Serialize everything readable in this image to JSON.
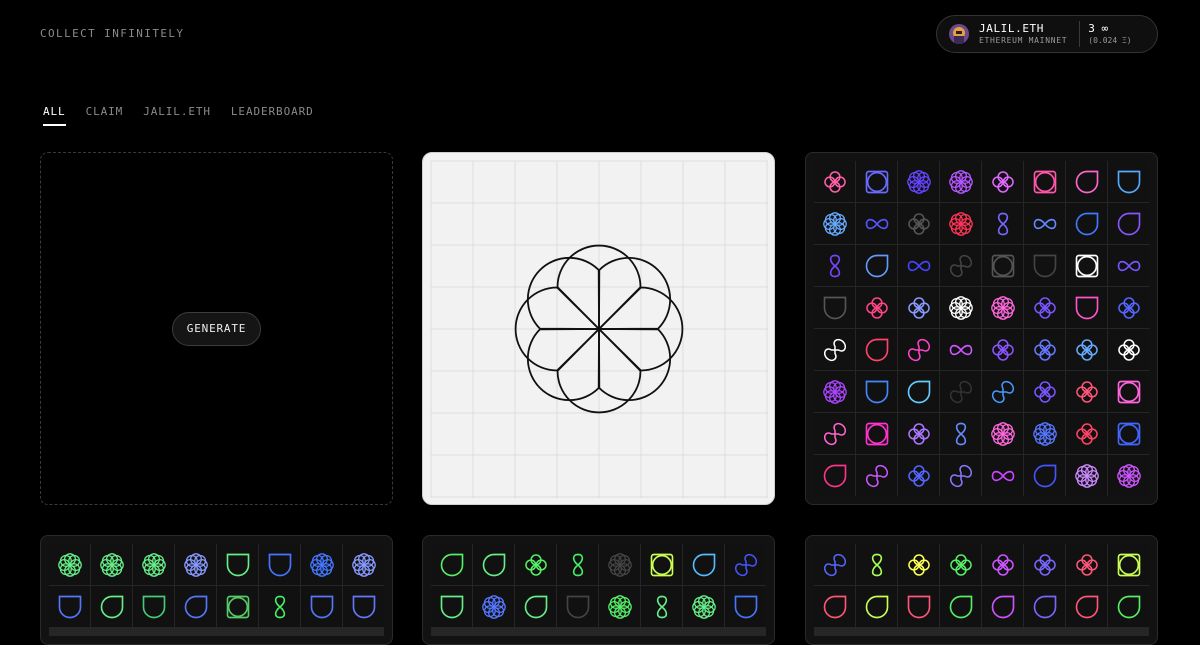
{
  "brand": "COLLECT INFINITELY",
  "wallet": {
    "name": "JALIL.ETH",
    "network": "ETHEREUM MAINNET",
    "count": "3 ∞",
    "eth": "(0.024 Ξ)"
  },
  "tabs": [
    {
      "label": "ALL",
      "active": true
    },
    {
      "label": "CLAIM",
      "active": false
    },
    {
      "label": "JALIL.ETH",
      "active": false
    },
    {
      "label": "LEADERBOARD",
      "active": false
    }
  ],
  "generate_label": "GENERATE",
  "preview": {
    "shape": "flower8",
    "stroke": "#111111"
  },
  "collections": [
    {
      "cols": 8,
      "rows": 8,
      "tokens": [
        {
          "s": "clover",
          "c": "#ff5fa8"
        },
        {
          "s": "square",
          "c": "#6a6aff"
        },
        {
          "s": "flower",
          "c": "#6644ff"
        },
        {
          "s": "flower",
          "c": "#b455ff"
        },
        {
          "s": "clover",
          "c": "#e066ff"
        },
        {
          "s": "square",
          "c": "#ff55aa"
        },
        {
          "s": "drop",
          "c": "#ff66cc"
        },
        {
          "s": "arch",
          "c": "#55aaff"
        },
        {
          "s": "flower",
          "c": "#66aaff"
        },
        {
          "s": "inf",
          "c": "#5555ff"
        },
        {
          "s": "clover",
          "c": "#555555"
        },
        {
          "s": "flower",
          "c": "#ff3355"
        },
        {
          "s": "eight",
          "c": "#7766ff"
        },
        {
          "s": "inf",
          "c": "#6688ff"
        },
        {
          "s": "drop",
          "c": "#4477ff"
        },
        {
          "s": "drop",
          "c": "#8855ff"
        },
        {
          "s": "eight",
          "c": "#7744ff"
        },
        {
          "s": "drop",
          "c": "#6699ff"
        },
        {
          "s": "inf",
          "c": "#4444ff"
        },
        {
          "s": "wave",
          "c": "#444444"
        },
        {
          "s": "square",
          "c": "#555555"
        },
        {
          "s": "arch",
          "c": "#444444"
        },
        {
          "s": "square",
          "c": "#ffffff"
        },
        {
          "s": "inf",
          "c": "#7755ff"
        },
        {
          "s": "arch",
          "c": "#555555"
        },
        {
          "s": "clover",
          "c": "#ff4488"
        },
        {
          "s": "clover",
          "c": "#8899ff"
        },
        {
          "s": "flower",
          "c": "#ffffff"
        },
        {
          "s": "flower",
          "c": "#ff66dd"
        },
        {
          "s": "clover",
          "c": "#7755ff"
        },
        {
          "s": "arch",
          "c": "#ff55cc"
        },
        {
          "s": "clover",
          "c": "#5566ff"
        },
        {
          "s": "wave",
          "c": "#ffffff"
        },
        {
          "s": "drop",
          "c": "#ff4466"
        },
        {
          "s": "wave",
          "c": "#ff44cc"
        },
        {
          "s": "inf",
          "c": "#cc55ff"
        },
        {
          "s": "clover",
          "c": "#8855ff"
        },
        {
          "s": "clover",
          "c": "#6677ff"
        },
        {
          "s": "clover",
          "c": "#66aaff"
        },
        {
          "s": "clover",
          "c": "#ffffff"
        },
        {
          "s": "flower",
          "c": "#aa44ff"
        },
        {
          "s": "arch",
          "c": "#4488ff"
        },
        {
          "s": "drop",
          "c": "#66ccff"
        },
        {
          "s": "wave",
          "c": "#333333"
        },
        {
          "s": "wave",
          "c": "#4499ff"
        },
        {
          "s": "clover",
          "c": "#7755ff"
        },
        {
          "s": "clover",
          "c": "#ff5577"
        },
        {
          "s": "square",
          "c": "#ff66dd"
        },
        {
          "s": "wave",
          "c": "#ff66cc"
        },
        {
          "s": "square",
          "c": "#ff33cc"
        },
        {
          "s": "clover",
          "c": "#aa77ff"
        },
        {
          "s": "eight",
          "c": "#6688ff"
        },
        {
          "s": "flower",
          "c": "#ff66dd"
        },
        {
          "s": "flower",
          "c": "#5577ff"
        },
        {
          "s": "clover",
          "c": "#ff4466"
        },
        {
          "s": "square",
          "c": "#4466ff"
        },
        {
          "s": "drop",
          "c": "#ff3388"
        },
        {
          "s": "wave",
          "c": "#cc55ff"
        },
        {
          "s": "clover",
          "c": "#5566ff"
        },
        {
          "s": "wave",
          "c": "#8877ff"
        },
        {
          "s": "inf",
          "c": "#cc44ff"
        },
        {
          "s": "drop",
          "c": "#4455ff"
        },
        {
          "s": "flower",
          "c": "#cc88ff"
        },
        {
          "s": "flower",
          "c": "#cc55ff"
        }
      ]
    },
    {
      "cols": 8,
      "rows": 2,
      "tokens": [
        {
          "s": "flower",
          "c": "#66ee88"
        },
        {
          "s": "flower",
          "c": "#66ee88"
        },
        {
          "s": "flower",
          "c": "#66ee88"
        },
        {
          "s": "flower",
          "c": "#8899ff"
        },
        {
          "s": "arch",
          "c": "#66ee88"
        },
        {
          "s": "arch",
          "c": "#4477ff"
        },
        {
          "s": "flower",
          "c": "#4477ff"
        },
        {
          "s": "flower",
          "c": "#8899ff"
        },
        {
          "s": "arch",
          "c": "#5577ff"
        },
        {
          "s": "drop",
          "c": "#66ee88"
        },
        {
          "s": "arch",
          "c": "#44cc77"
        },
        {
          "s": "drop",
          "c": "#5577ff"
        },
        {
          "s": "square",
          "c": "#55cc66"
        },
        {
          "s": "eight",
          "c": "#44ee66"
        },
        {
          "s": "arch",
          "c": "#5577ff"
        },
        {
          "s": "arch",
          "c": "#6677ff"
        }
      ]
    },
    {
      "cols": 8,
      "rows": 2,
      "tokens": [
        {
          "s": "drop",
          "c": "#55ee66"
        },
        {
          "s": "drop",
          "c": "#66ee88"
        },
        {
          "s": "clover",
          "c": "#55ee66"
        },
        {
          "s": "eight",
          "c": "#44ee66"
        },
        {
          "s": "flower",
          "c": "#444444"
        },
        {
          "s": "square",
          "c": "#ccff55"
        },
        {
          "s": "drop",
          "c": "#55bbff"
        },
        {
          "s": "wave",
          "c": "#4455ff"
        },
        {
          "s": "arch",
          "c": "#66ee88"
        },
        {
          "s": "flower",
          "c": "#5577ff"
        },
        {
          "s": "drop",
          "c": "#66ee88"
        },
        {
          "s": "arch",
          "c": "#444444"
        },
        {
          "s": "flower",
          "c": "#55ee66"
        },
        {
          "s": "eight",
          "c": "#66ee88"
        },
        {
          "s": "flower",
          "c": "#66ee88"
        },
        {
          "s": "arch",
          "c": "#4477ff"
        }
      ]
    },
    {
      "cols": 8,
      "rows": 2,
      "tokens": [
        {
          "s": "wave",
          "c": "#5566ff"
        },
        {
          "s": "eight",
          "c": "#aaff55"
        },
        {
          "s": "clover",
          "c": "#ffff55"
        },
        {
          "s": "clover",
          "c": "#55ee66"
        },
        {
          "s": "clover",
          "c": "#cc55ff"
        },
        {
          "s": "clover",
          "c": "#7766ff"
        },
        {
          "s": "clover",
          "c": "#ff5577"
        },
        {
          "s": "square",
          "c": "#ccff55"
        },
        {
          "s": "drop",
          "c": "#ff5577"
        },
        {
          "s": "drop",
          "c": "#ccff55"
        },
        {
          "s": "arch",
          "c": "#ff5577"
        },
        {
          "s": "drop",
          "c": "#55ee66"
        },
        {
          "s": "drop",
          "c": "#cc55ff"
        },
        {
          "s": "drop",
          "c": "#7766ff"
        },
        {
          "s": "drop",
          "c": "#ff5577"
        },
        {
          "s": "drop",
          "c": "#55ee66"
        }
      ]
    }
  ]
}
